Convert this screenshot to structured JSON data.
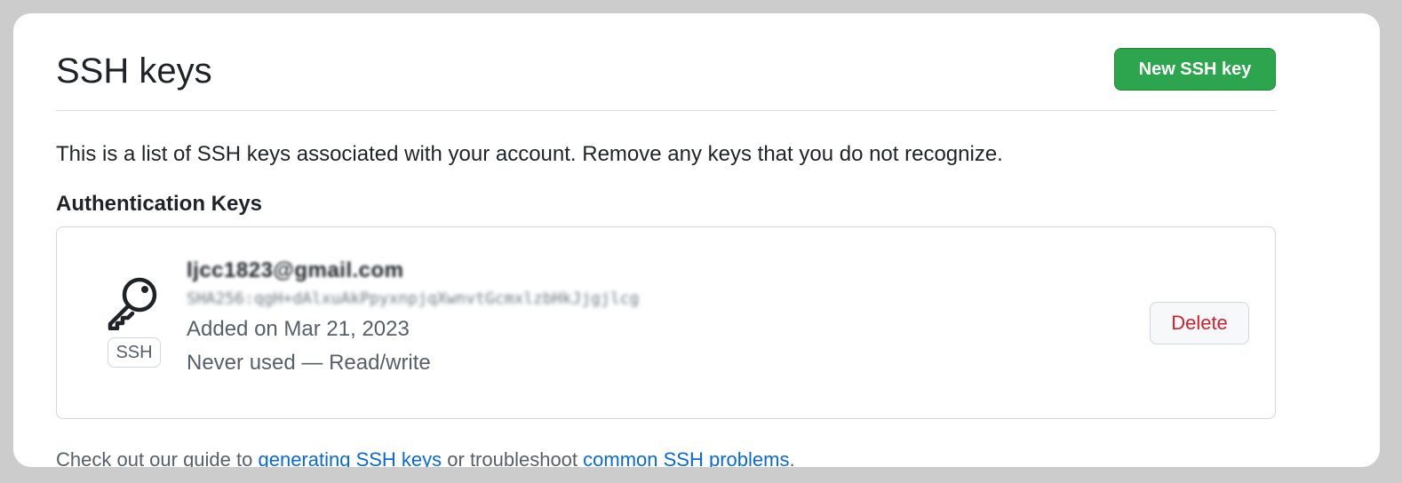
{
  "header": {
    "title": "SSH keys",
    "new_key_label": "New SSH key"
  },
  "description": "This is a list of SSH keys associated with your account. Remove any keys that you do not recognize.",
  "section_title": "Authentication Keys",
  "keys": [
    {
      "badge": "SSH",
      "icon": "key-icon",
      "title": "ljcc1823@gmail.com",
      "fingerprint": "SHA256:qgH+dAlxuAkPpyxnpjqXwnvtGcmxlzbHkJjgjlcg",
      "added": "Added on Mar 21, 2023",
      "usage": "Never used — Read/write",
      "delete_label": "Delete"
    }
  ],
  "footer": {
    "prefix": "Check out our guide to ",
    "link1": "generating SSH keys",
    "middle": " or troubleshoot ",
    "link2": "common SSH problems",
    "suffix": "."
  },
  "colors": {
    "primary_button": "#2da44e",
    "danger": "#cf222e",
    "link": "#0969da"
  }
}
